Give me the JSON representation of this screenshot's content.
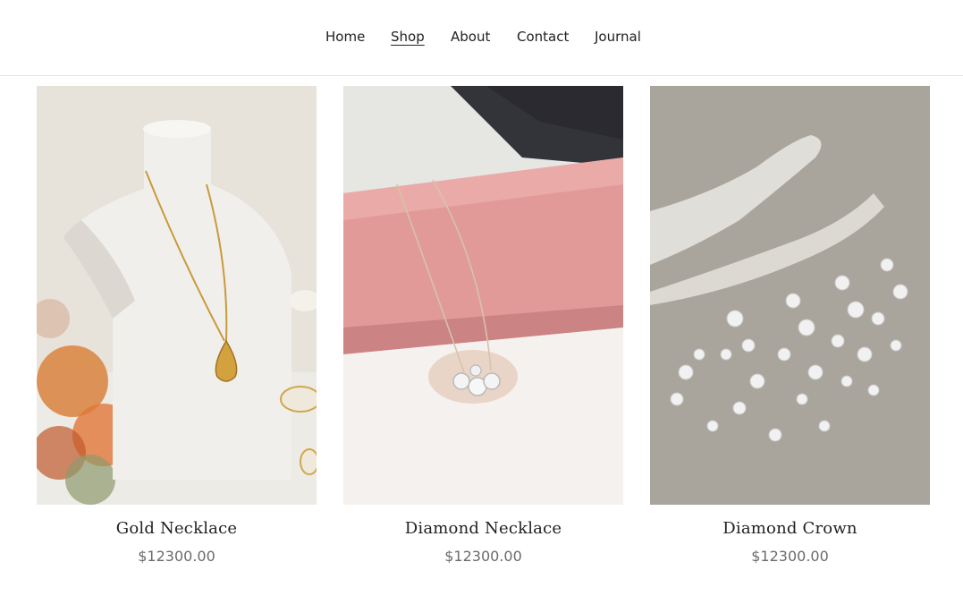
{
  "nav": {
    "items": [
      {
        "label": "Home",
        "active": false
      },
      {
        "label": "Shop",
        "active": true
      },
      {
        "label": "About",
        "active": false
      },
      {
        "label": "Contact",
        "active": false
      },
      {
        "label": "Journal",
        "active": false
      }
    ]
  },
  "products": [
    {
      "name": "Gold Necklace",
      "price": "$12300.00",
      "image_icon": "gold-necklace-photo"
    },
    {
      "name": "Diamond Necklace",
      "price": "$12300.00",
      "image_icon": "diamond-necklace-photo"
    },
    {
      "name": "Diamond Crown",
      "price": "$12300.00",
      "image_icon": "diamond-crown-photo"
    }
  ]
}
